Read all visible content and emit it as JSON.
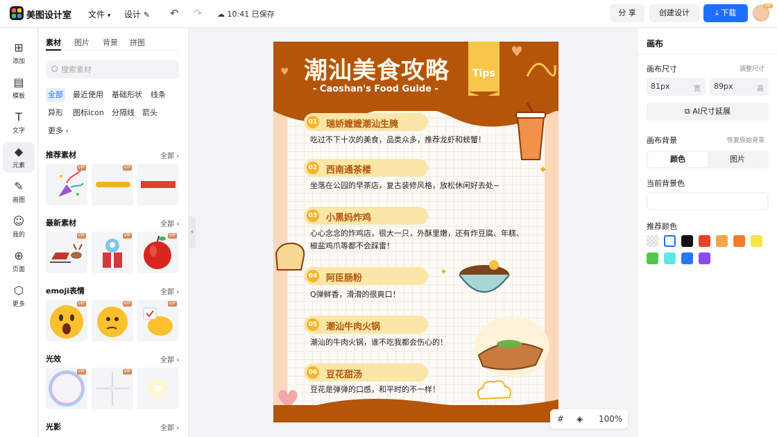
{
  "header": {
    "app_name": "美图设计室",
    "menu_file": "文件",
    "menu_design": "设计",
    "save_status": "10:41 已保存",
    "share": "分 享",
    "create_design": "创建设计",
    "download": "下载",
    "vip_badge": "VIP"
  },
  "leftnav": {
    "items": [
      {
        "label": "添加",
        "icon": "plus-square-icon"
      },
      {
        "label": "模板",
        "icon": "template-icon"
      },
      {
        "label": "文字",
        "icon": "text-icon"
      },
      {
        "label": "元素",
        "icon": "elements-icon"
      },
      {
        "label": "画图",
        "icon": "draw-icon"
      },
      {
        "label": "我的",
        "icon": "user-icon"
      },
      {
        "label": "页面",
        "icon": "page-icon"
      },
      {
        "label": "更多",
        "icon": "more-cube-icon"
      }
    ]
  },
  "panel": {
    "tabs": [
      "素材",
      "图片",
      "背景",
      "拼图"
    ],
    "search_placeholder": "搜索素材",
    "chips": [
      "全部",
      "最近使用",
      "基础形状",
      "线条",
      "异形",
      "图标icon",
      "分隔线",
      "箭头",
      "更多"
    ],
    "sections": [
      {
        "title": "推荐素材",
        "all": "全部"
      },
      {
        "title": "最新素材",
        "all": "全部"
      },
      {
        "title": "emoji表情",
        "all": "全部"
      },
      {
        "title": "光效",
        "all": "全部"
      },
      {
        "title": "光影",
        "all": "全部"
      }
    ],
    "vip": "VIP"
  },
  "poster": {
    "title": "潮汕美食攻略",
    "subtitle": "- Caoshan's Food Guide -",
    "tips": "Tips",
    "items": [
      {
        "num": "01",
        "title": "瑞娇嬷嬷潮汕生腌",
        "desc": "吃过不下十次的美食，品类众多，推荐龙虾和螃蟹！"
      },
      {
        "num": "02",
        "title": "西南通茶楼",
        "desc": "坐落在公园的早茶店，复古装修风格，放松休闲好去处~"
      },
      {
        "num": "03",
        "title": "小黑妈炸鸡",
        "desc": "心心念念的炸鸡店，很大一只，外酥里嫩，还有炸豆腐、年糕、椒盐鸡爪等都不会踩雷！"
      },
      {
        "num": "04",
        "title": "阿臣肠粉",
        "desc": "Q弹鲜香，滑滑的很爽口！"
      },
      {
        "num": "05",
        "title": "潮汕牛肉火锅",
        "desc": "潮汕的牛肉火锅，谁不吃我都会伤心的！"
      },
      {
        "num": "06",
        "title": "豆花甜汤",
        "desc": "豆花是弹弹的口感，和平时的不一样！"
      }
    ]
  },
  "zoom": {
    "value": "100%"
  },
  "right": {
    "heading": "画布",
    "size_label": "画布尺寸",
    "adjust_size": "调整尺寸",
    "width_value": "81px",
    "width_unit": "宽",
    "height_value": "89px",
    "height_unit": "高",
    "ai_extend": "AI尺寸延展",
    "bg_label": "画布背景",
    "restore_bg": "恢复原始背景",
    "seg_color": "颜色",
    "seg_image": "图片",
    "current_bg": "当前背景色",
    "recommended": "推荐颜色",
    "swatches": [
      "transparent",
      "#ffffff",
      "#111111",
      "#e8402a",
      "#f5a64b",
      "#f27a2d",
      "#f5e64a",
      "#52c74a",
      "#63e5e5",
      "#2979f2",
      "#8b4bf0"
    ]
  }
}
